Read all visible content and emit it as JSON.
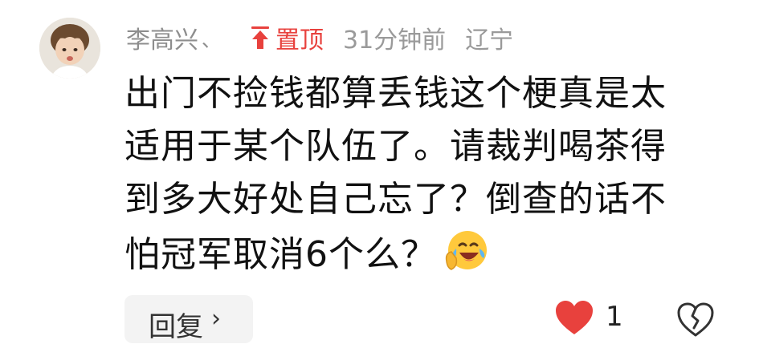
{
  "comment": {
    "username": "李高兴",
    "separator": "、",
    "pin_label": "置顶",
    "time": "31分钟前",
    "location": "辽宁",
    "content_lines": [
      "出门不捡钱都算丢钱这个梗真是太",
      "适用于某个队伍了。请裁判喝茶得",
      "到多大好处自己忘了？倒查的话不",
      "怕冠军取消6个么？"
    ],
    "emoji": "laughing-crying-emoji",
    "reply_label": "回复",
    "reply_chevron": "›",
    "like_count": "1"
  },
  "colors": {
    "pin": "#e8413d",
    "meta": "#9a9a9a",
    "text": "#111111",
    "like_heart": "#e8413d",
    "reply_bg": "#f3f3f3"
  },
  "icons": {
    "pin": "pin-up-arrow-icon",
    "like": "heart-icon",
    "dislike": "broken-heart-icon"
  }
}
